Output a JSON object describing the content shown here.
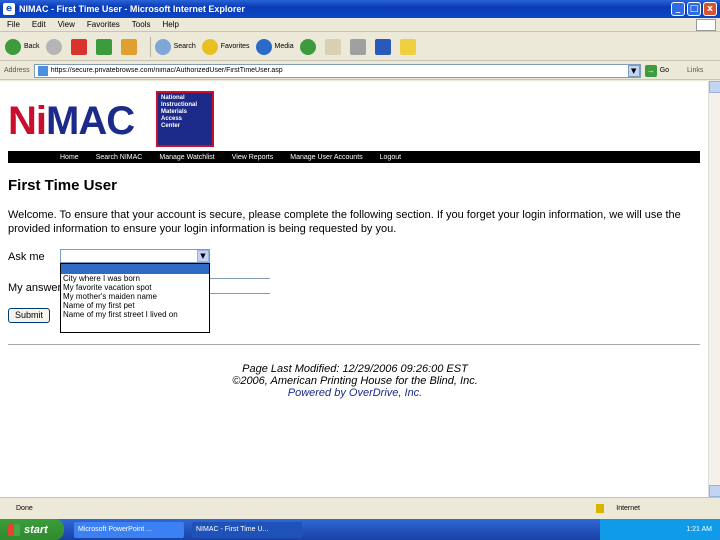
{
  "window": {
    "title": "NIMAC - First Time User - Microsoft Internet Explorer",
    "min": "_",
    "max": "□",
    "close": "x"
  },
  "menu": [
    "File",
    "Edit",
    "View",
    "Favorites",
    "Tools",
    "Help"
  ],
  "toolbar": {
    "back": "Back",
    "search": "Search",
    "favorites": "Favorites",
    "media": "Media"
  },
  "address": {
    "label": "Address",
    "url": "https://secure.privatebrowse.com/nimac/AuthorizedUser/FirstTimeUser.asp",
    "go": "Go",
    "links": "Links"
  },
  "logo": {
    "brand_ni": "Ni",
    "brand_mac": "MAC",
    "lines": [
      "National",
      "Instructional",
      "Materials",
      "Access",
      "Center"
    ]
  },
  "nav": [
    "Home",
    "Search NIMAC",
    "Manage Watchlist",
    "View Reports",
    "Manage User Accounts",
    "Logout"
  ],
  "content": {
    "heading": "First Time User",
    "welcome": "Welcome. To ensure that your account is secure, please complete the following section. If you forget your login information, we will use the provided information to ensure your login information is being requested by you.",
    "ask_label": "Ask me",
    "answer_label": "My answer",
    "options": [
      "City where I was born",
      "My favorite vacation spot",
      "My mother's maiden name",
      "Name of my first pet",
      "Name of my first street I lived on"
    ],
    "submit": "Submit"
  },
  "footer": {
    "modified": "Page Last Modified: 12/29/2006 09:26:00 EST",
    "copyright": "©2006, American Printing House for the Blind, Inc.",
    "powered": "Powered by OverDrive, Inc."
  },
  "status": {
    "text": "Done",
    "zone": "Internet"
  },
  "taskbar": {
    "start": "start",
    "tasks": [
      "Microsoft PowerPoint ...",
      "NIMAC - First Time U..."
    ],
    "clock": "1:21 AM"
  }
}
